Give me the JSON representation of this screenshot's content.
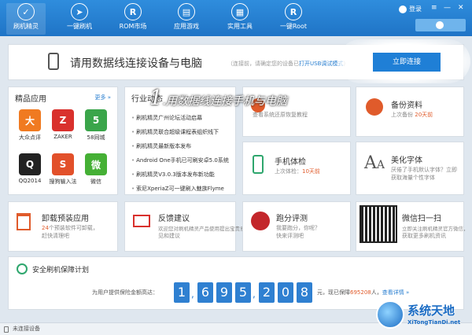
{
  "nav": {
    "items": [
      {
        "label": "刷机精灵",
        "glyph": "✓"
      },
      {
        "label": "一键刷机",
        "glyph": "➤"
      },
      {
        "label": "ROM市场",
        "glyph": "R"
      },
      {
        "label": "应用游戏",
        "glyph": "▤"
      },
      {
        "label": "实用工具",
        "glyph": "▦"
      },
      {
        "label": "一键Root",
        "glyph": "R"
      }
    ],
    "login": "登录",
    "controls": [
      "≡",
      "—",
      "✕"
    ]
  },
  "connect": {
    "title": "请用数据线连接设备与电脑",
    "sub_prefix": "（连接前，请确定您的设备已",
    "sub_link": "打开USB调试模式",
    "sub_suffix": "）",
    "button": "立即连接"
  },
  "annotation": {
    "number": "1",
    "text": ".用数据线连接手机与电脑"
  },
  "apps": {
    "title": "精品应用",
    "more": "更多 »",
    "items": [
      {
        "label": "大众点评",
        "glyph": "大",
        "color": "#f07a21"
      },
      {
        "label": "ZAKER",
        "glyph": "Z",
        "color": "#d9312d"
      },
      {
        "label": "58同城",
        "glyph": "5",
        "color": "#3aa54a"
      },
      {
        "label": "QQ2014",
        "glyph": "Q",
        "color": "#222222"
      },
      {
        "label": "搜狗输入法",
        "glyph": "S",
        "color": "#e2502a"
      },
      {
        "label": "微信",
        "glyph": "微",
        "color": "#45b035"
      }
    ]
  },
  "news": {
    "title": "行业动态",
    "items": [
      "刷机精灵广州论坛活动启幕",
      "刷机精灵联合超级课程表组织线下",
      "刷机精灵最新版本发布",
      "Android One手机已可刷安卓5.0系统",
      "刷机精灵V3.0.3版本发布新功能",
      "索尼XperiaZ可一键刷入魅族Flyme"
    ]
  },
  "cards": {
    "restore": {
      "sub": "查看系统还原恢复教程"
    },
    "backup": {
      "title": "备份资料",
      "sub_prefix": "上次备份",
      "sub_value": "20天前"
    },
    "check": {
      "title": "手机体检",
      "sub_prefix": "上次体检：",
      "sub_value": "10天前"
    },
    "font": {
      "title": "美化字体",
      "sub1": "厌倦了手机默认字体？立即",
      "sub2": "获取海量个性字体"
    },
    "uninstall": {
      "title": "卸载预装应用",
      "sub_count": "24",
      "sub_rest": "个预装软件可卸载，",
      "sub2": "赶快清理吧"
    },
    "feedback": {
      "title": "反馈建议",
      "sub1": "欢迎您对刷机精灵产品使用提出宝贵意",
      "sub2": "见和建议"
    },
    "bench": {
      "title": "跑分评测",
      "sub1": "我要跑分，你呢？",
      "sub2": "快来评测吧"
    },
    "wechat": {
      "title": "微信扫一扫",
      "sub1": "立即关注刷机精灵官方微信，",
      "sub2": "获取更多刷机资讯"
    }
  },
  "guarantee": {
    "title": "安全刷机保障计划",
    "lead": "为用户提供保险金额高达：",
    "digits": [
      "1",
      "6",
      "9",
      "5",
      "2",
      "0",
      "8"
    ],
    "tail_prefix": "元，现已保障",
    "tail_count": "695208",
    "tail_suffix": "人，",
    "tail_link": "查看详情 »"
  },
  "status": "未连接设备",
  "watermark": {
    "title": "系统天地",
    "url": "XiTongTianDi.net"
  }
}
